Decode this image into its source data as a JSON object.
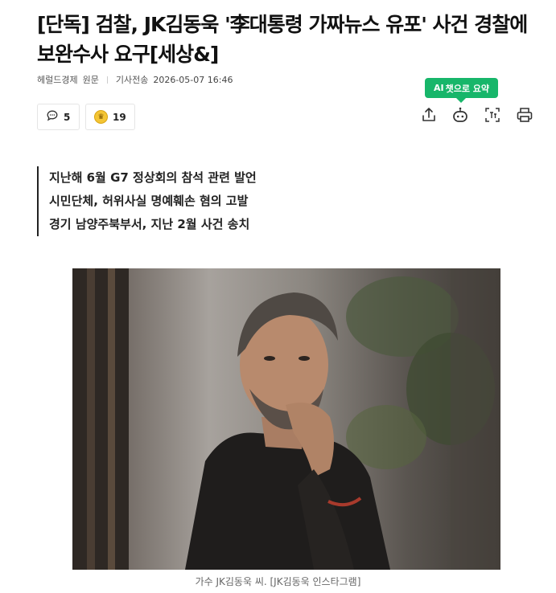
{
  "article": {
    "headline": "[단독] 검찰, JK김동욱 '李대통령 가짜뉴스 유포' 사건 경찰에 보완수사 요구[세상&]",
    "source": "헤럴드경제",
    "original_link": "원문",
    "date_label": "기사전송",
    "date": "2026-05-07 16:46"
  },
  "reactions": {
    "comment_count": "5",
    "reaction_count": "19",
    "reaction_icon_text": "♛"
  },
  "toolbar": {
    "ai_label": "AI",
    "ai_tooltip": "챗으로 요약",
    "accent_color": "#17b66a",
    "icons": [
      "share-icon",
      "ai-chat-icon",
      "text-size-icon",
      "print-icon"
    ]
  },
  "summary": [
    "지난해 6월 G7 정상회의 참석 관련 발언",
    "시민단체, 허위사실 명예훼손 혐의 고발",
    "경기 남양주북부서, 지난 2월 사건 송치"
  ],
  "photo": {
    "caption": "가수 JK김동욱 씨. [JK김동욱 인스타그램]"
  }
}
